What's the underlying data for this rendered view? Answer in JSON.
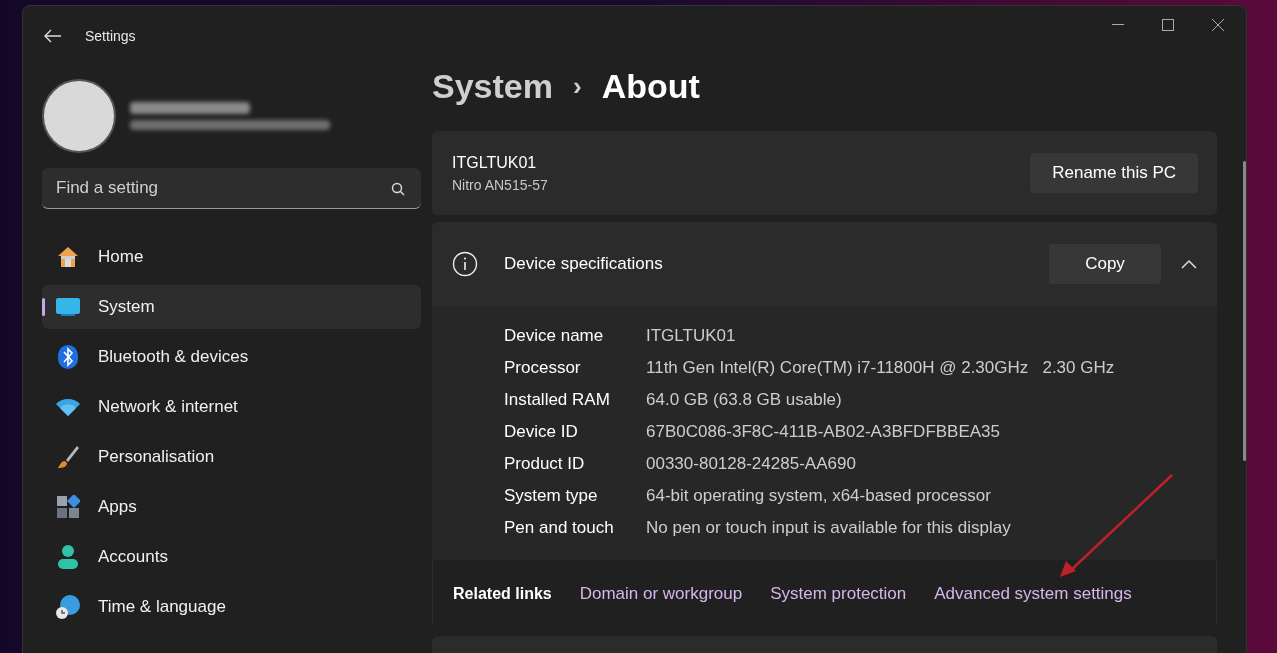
{
  "window": {
    "title": "Settings"
  },
  "search": {
    "placeholder": "Find a setting"
  },
  "sidebar": {
    "items": [
      {
        "label": "Home",
        "kind": "home",
        "selected": false
      },
      {
        "label": "System",
        "kind": "system",
        "selected": true
      },
      {
        "label": "Bluetooth & devices",
        "kind": "bluetooth",
        "selected": false
      },
      {
        "label": "Network & internet",
        "kind": "network",
        "selected": false
      },
      {
        "label": "Personalisation",
        "kind": "brush",
        "selected": false
      },
      {
        "label": "Apps",
        "kind": "apps",
        "selected": false
      },
      {
        "label": "Accounts",
        "kind": "accounts",
        "selected": false
      },
      {
        "label": "Time & language",
        "kind": "time",
        "selected": false
      }
    ]
  },
  "breadcrumb": {
    "parent": "System",
    "separator": "›",
    "current": "About"
  },
  "pc": {
    "name": "ITGLTUK01",
    "model": "Nitro AN515-57",
    "rename_button": "Rename this PC"
  },
  "device_specifications": {
    "title": "Device specifications",
    "copy_button": "Copy",
    "expanded": true,
    "rows": [
      {
        "label": "Device name",
        "value": "ITGLTUK01"
      },
      {
        "label": "Processor",
        "value": "11th Gen Intel(R) Core(TM) i7-11800H @ 2.30GHz   2.30 GHz"
      },
      {
        "label": "Installed RAM",
        "value": "64.0 GB (63.8 GB usable)"
      },
      {
        "label": "Device ID",
        "value": "67B0C086-3F8C-411B-AB02-A3BFDFBBEA35"
      },
      {
        "label": "Product ID",
        "value": "00330-80128-24285-AA690"
      },
      {
        "label": "System type",
        "value": "64-bit operating system, x64-based processor"
      },
      {
        "label": "Pen and touch",
        "value": "No pen or touch input is available for this display"
      }
    ]
  },
  "related_links": {
    "title": "Related links",
    "links": [
      "Domain or workgroup",
      "System protection",
      "Advanced system settings"
    ]
  }
}
